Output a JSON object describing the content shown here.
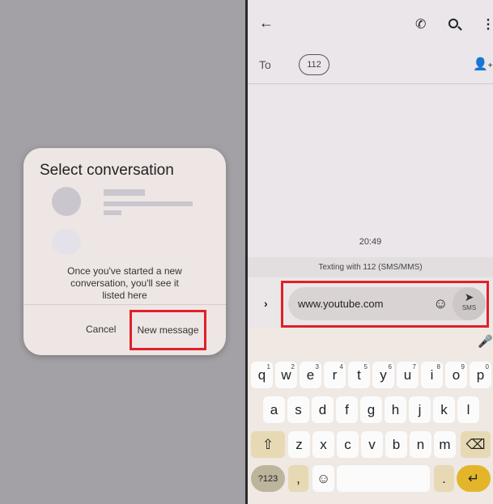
{
  "left_screen": {
    "dialog": {
      "title": "Select conversation",
      "body": "Once you've started a new conversation, you'll see it listed here",
      "cancel_label": "Cancel",
      "new_message_label": "New message"
    }
  },
  "right_screen": {
    "header": {
      "back_icon": "arrow-left-icon",
      "call_icon": "phone-icon",
      "search_icon": "search-icon",
      "more_icon": "more-vert-icon"
    },
    "recipients": {
      "to_label": "To",
      "chip": "112",
      "add_icon": "add-person-icon"
    },
    "timestamp": "20:49",
    "banner": "Texting with 112 (SMS/MMS)",
    "compose": {
      "text": "www.youtube.com",
      "send_label": "SMS"
    },
    "highlight_color": "#e0202a",
    "keyboard": {
      "row1": [
        "q",
        "w",
        "e",
        "r",
        "t",
        "y",
        "u",
        "i",
        "o",
        "p"
      ],
      "row1_hints": [
        "1",
        "2",
        "3",
        "4",
        "5",
        "6",
        "7",
        "8",
        "9",
        "0"
      ],
      "row2": [
        "a",
        "s",
        "d",
        "f",
        "g",
        "h",
        "j",
        "k",
        "l"
      ],
      "row3": [
        "z",
        "x",
        "c",
        "v",
        "b",
        "n",
        "m"
      ],
      "symbols_label": "?123",
      "comma": ",",
      "period": "."
    }
  }
}
